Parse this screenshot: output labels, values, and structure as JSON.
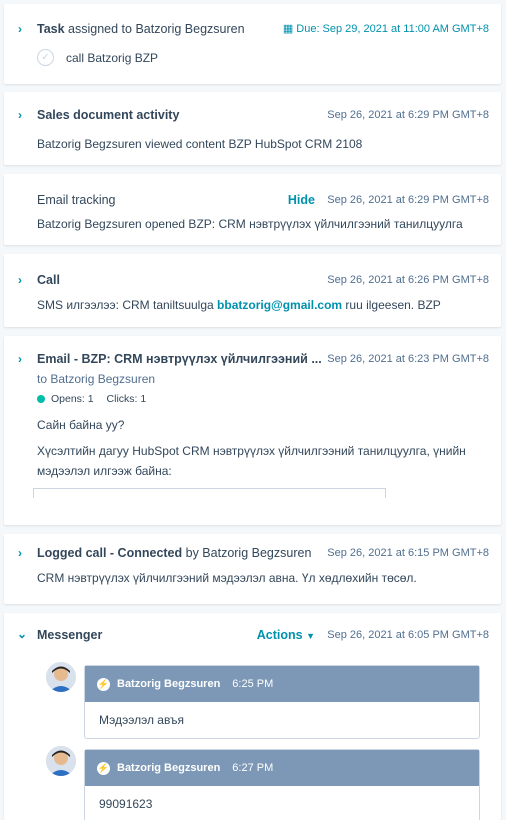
{
  "task": {
    "title_bold": "Task",
    "title_rest": " assigned to Batzorig Begzsuren",
    "due": "Due: Sep 29, 2021 at 11:00 AM GMT+8",
    "text": "call Batzorig BZP"
  },
  "sales": {
    "title": "Sales document activity",
    "ts": "Sep 26, 2021 at 6:29 PM GMT+8",
    "text": "Batzorig Begzsuren viewed content BZP HubSpot CRM 2108"
  },
  "tracking": {
    "title": "Email tracking",
    "hide": "Hide",
    "ts": "Sep 26, 2021 at 6:29 PM GMT+8",
    "text": "Batzorig Begzsuren opened BZP: CRM нэвтрүүлэх үйлчилгээний танилцуулга"
  },
  "call": {
    "title": "Call",
    "ts": "Sep 26, 2021 at 6:26 PM GMT+8",
    "text_pre": "SMS илгээлээ: CRM taniltsuulga ",
    "email": "bbatzorig@gmail.com",
    "text_post": " ruu ilgeesen. BZP"
  },
  "email": {
    "title": "Email - BZP: CRM нэвтрүүлэх үйлчилгээний ...",
    "ts": "Sep 26, 2021 at 6:23 PM GMT+8",
    "to": "to Batzorig Begzsuren",
    "opens": "Opens: 1",
    "clicks": "Clicks: 1",
    "line1": "Сайн байна уу?",
    "line2": "Хүсэлтийн дагуу HubSpot CRM нэвтрүүлэх үйлчилгээний танилцуулга, үнийн",
    "line3": "мэдээлэл илгээж байна:"
  },
  "logged": {
    "title_bold": "Logged call - Connected",
    "title_rest": " by Batzorig Begzsuren",
    "ts": "Sep 26, 2021 at 6:15 PM GMT+8",
    "text": "CRM нэвтрүүлэх үйлчилгээний мэдээлэл авна. Үл хөдлөхийн төсөл."
  },
  "messenger": {
    "title": "Messenger",
    "actions": "Actions",
    "ts": "Sep 26, 2021 at 6:05 PM GMT+8",
    "messages": [
      {
        "sender": "Batzorig Begzsuren",
        "time": "6:25 PM",
        "text": "Мэдээлэл авъя"
      },
      {
        "sender": "Batzorig Begzsuren",
        "time": "6:27 PM",
        "text": "99091623"
      }
    ]
  },
  "colors": {
    "accent": "#0091ae",
    "header": "#7c98b6",
    "text": "#33475b",
    "opens": "#00bda5"
  }
}
